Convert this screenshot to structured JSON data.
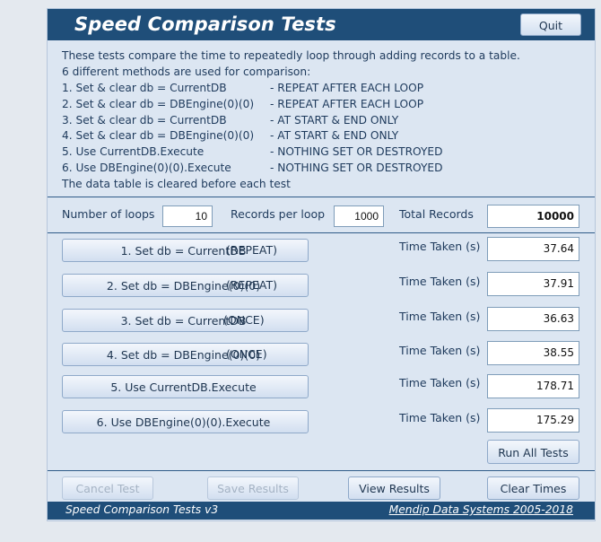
{
  "header": {
    "title": "Speed Comparison Tests",
    "quit_label": "Quit"
  },
  "intro": {
    "line1": "These tests compare the time to repeatedly loop through adding records to a table.",
    "line2": "6 different methods are used for comparison:",
    "methods": [
      {
        "label": "1. Set & clear db = CurrentDB",
        "desc": "- REPEAT AFTER EACH LOOP"
      },
      {
        "label": "2. Set & clear db = DBEngine(0)(0)",
        "desc": "- REPEAT AFTER EACH LOOP"
      },
      {
        "label": "3. Set & clear db = CurrentDB",
        "desc": "- AT START & END ONLY"
      },
      {
        "label": "4. Set & clear db = DBEngine(0)(0)",
        "desc": "- AT START & END ONLY"
      },
      {
        "label": "5. Use CurrentDB.Execute",
        "desc": "- NOTHING SET OR DESTROYED"
      },
      {
        "label": "6. Use DBEngine(0)(0).Execute",
        "desc": "- NOTHING SET OR DESTROYED"
      }
    ],
    "footer_line": "The data table is cleared before each test"
  },
  "settings": {
    "loops_label": "Number of loops",
    "loops_value": "10",
    "records_label": "Records per loop",
    "records_value": "1000",
    "total_label": "Total Records",
    "total_value": "10000"
  },
  "tests": [
    {
      "label": "1. Set db = CurrentDB",
      "mode": "(REPEAT)",
      "time_label": "Time Taken (s)",
      "time": "37.64"
    },
    {
      "label": "2. Set db = DBEngine(0)(0)",
      "mode": "(REPEAT)",
      "time_label": "Time Taken (s)",
      "time": "37.91"
    },
    {
      "label": "3. Set db = CurrentDB",
      "mode": "(ONCE)",
      "time_label": "Time Taken (s)",
      "time": "36.63"
    },
    {
      "label": "4. Set db = DBEngine(0)(0)",
      "mode": "(ONCE)",
      "time_label": "Time Taken (s)",
      "time": "38.55"
    },
    {
      "label": "5. Use CurrentDB.Execute",
      "mode": "",
      "time_label": "Time Taken (s)",
      "time": "178.71"
    },
    {
      "label": "6. Use DBEngine(0)(0).Execute",
      "mode": "",
      "time_label": "Time Taken (s)",
      "time": "175.29"
    }
  ],
  "actions": {
    "run_all": "Run All Tests",
    "cancel": "Cancel Test",
    "save": "Save Results",
    "view": "View Results",
    "clear": "Clear Times"
  },
  "footer": {
    "version": "Speed Comparison Tests v3",
    "copyright": "Mendip Data Systems 2005-2018"
  },
  "colors": {
    "header_bg": "#1f4e79",
    "form_bg": "#dce6f2",
    "text": "#1e3a5c"
  }
}
